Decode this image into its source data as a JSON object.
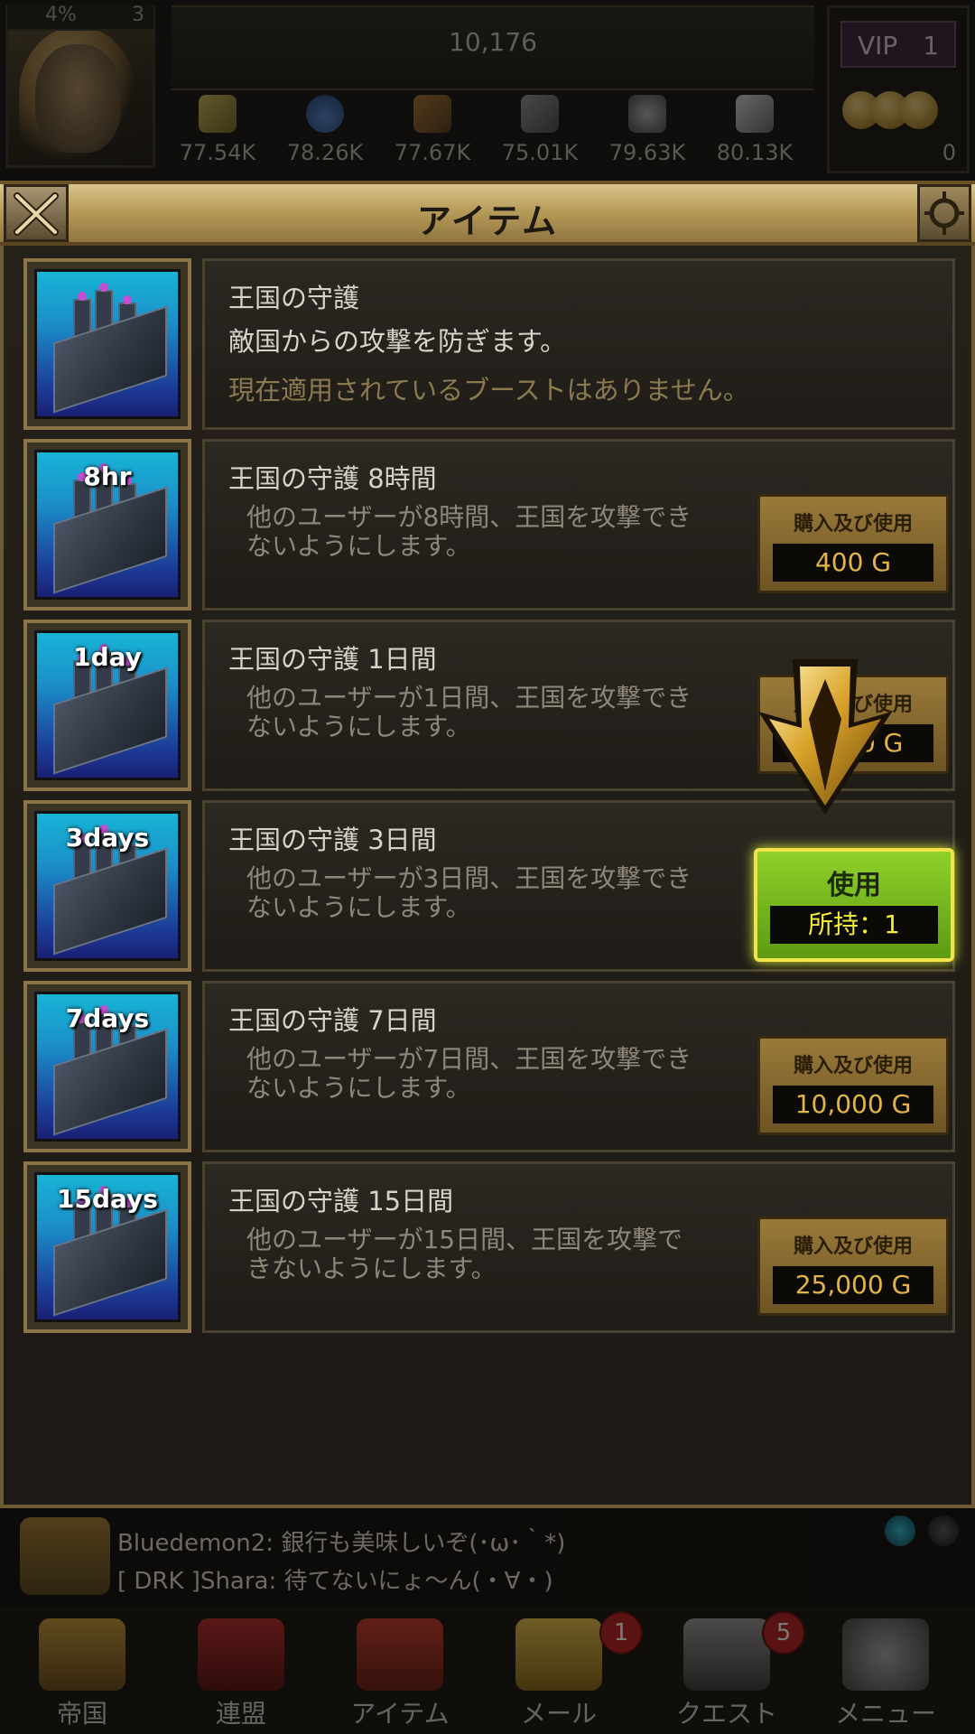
{
  "hud": {
    "xp_percent": "4%",
    "level": "3",
    "power": "10,176",
    "resources": [
      {
        "name": "food-icon",
        "value": "77.54K",
        "color": "#b8a040"
      },
      {
        "name": "water-icon",
        "value": "78.26K",
        "color": "#3a6ab8"
      },
      {
        "name": "wood-icon",
        "value": "77.67K",
        "color": "#8a5a2a"
      },
      {
        "name": "stone-icon",
        "value": "75.01K",
        "color": "#7a7a7a"
      },
      {
        "name": "ore-icon",
        "value": "79.63K",
        "color": "#9a9a9a"
      },
      {
        "name": "silver-icon",
        "value": "80.13K",
        "color": "#c8c8c8"
      }
    ],
    "vip": "VIP　1",
    "gold": "0"
  },
  "panel": {
    "title": "アイテム"
  },
  "items": [
    {
      "duration": "",
      "name": "王国の守護",
      "desc": "敵国からの攻撃を防ぎます。",
      "status": "現在適用されているブーストはありません。"
    },
    {
      "duration": "8hr",
      "name": "王国の守護 8時間",
      "desc": "他のユーザーが8時間、王国を攻撃できないようにします。",
      "button_top": "購入及び使用",
      "button_price": "400 G"
    },
    {
      "duration": "1day",
      "name": "王国の守護 1日間",
      "desc": "他のユーザーが1日間、王国を攻撃できないようにします。",
      "button_top": "購入及び使用",
      "button_price": "2,000 G"
    },
    {
      "duration": "3days",
      "name": "王国の守護 3日間",
      "desc": "他のユーザーが3日間、王国を攻撃できないようにします。",
      "button_top": "使用",
      "button_price": "所持：1"
    },
    {
      "duration": "7days",
      "name": "王国の守護 7日間",
      "desc": "他のユーザーが7日間、王国を攻撃できないようにします。",
      "button_top": "購入及び使用",
      "button_price": "10,000 G"
    },
    {
      "duration": "15days",
      "name": "王国の守護 15日間",
      "desc": "他のユーザーが15日間、王国を攻撃できないようにします。",
      "button_top": "購入及び使用",
      "button_price": "25,000 G"
    }
  ],
  "chat": {
    "line1": "Bluedemon2: 銀行も美味しいぞ(･ω･｀*)",
    "line2": "[ DRK ]Shara: 待てないにょ～ん(・∀・)"
  },
  "nav": [
    {
      "label": "帝国",
      "badge": ""
    },
    {
      "label": "連盟",
      "badge": ""
    },
    {
      "label": "アイテム",
      "badge": ""
    },
    {
      "label": "メール",
      "badge": "1"
    },
    {
      "label": "クエスト",
      "badge": "5"
    },
    {
      "label": "メニュー",
      "badge": ""
    }
  ]
}
